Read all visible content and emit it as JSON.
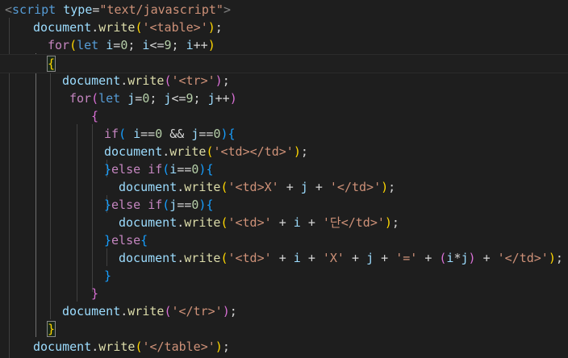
{
  "colors": {
    "background": "#1e1e1e",
    "tag": "#569cd6",
    "attribute": "#9cdcfe",
    "string": "#ce9178",
    "keyword": "#c586c0",
    "function": "#dcdcaa",
    "number": "#b5cea8",
    "bracket_level_1": "#ffd700",
    "bracket_level_2": "#da70d6",
    "bracket_level_3": "#179fff"
  },
  "lines": [
    [
      [
        "punc",
        "<"
      ],
      [
        "tag",
        "script"
      ],
      [
        "tok",
        " "
      ],
      [
        "attr",
        "type"
      ],
      [
        "tok",
        "="
      ],
      [
        "str",
        "\"text/javascript\""
      ],
      [
        "punc",
        ">"
      ]
    ],
    [
      [
        "var",
        "document"
      ],
      [
        "tok",
        "."
      ],
      [
        "fn",
        "write"
      ],
      [
        "b1",
        "("
      ],
      [
        "str",
        "'<table>'"
      ],
      [
        "b1",
        ")"
      ],
      [
        "tok",
        ";"
      ]
    ],
    [
      [
        "kw",
        "for"
      ],
      [
        "b1",
        "("
      ],
      [
        "decl",
        "let"
      ],
      [
        "tok",
        " "
      ],
      [
        "var",
        "i"
      ],
      [
        "op",
        "="
      ],
      [
        "num",
        "0"
      ],
      [
        "tok",
        "; "
      ],
      [
        "var",
        "i"
      ],
      [
        "op",
        "<="
      ],
      [
        "num",
        "9"
      ],
      [
        "tok",
        "; "
      ],
      [
        "var",
        "i"
      ],
      [
        "op",
        "++"
      ],
      [
        "b1",
        ")"
      ]
    ],
    [
      [
        "b1",
        "{"
      ]
    ],
    [
      [
        "var",
        "document"
      ],
      [
        "tok",
        "."
      ],
      [
        "fn",
        "write"
      ],
      [
        "b2",
        "("
      ],
      [
        "str",
        "'<tr>'"
      ],
      [
        "b2",
        ")"
      ],
      [
        "tok",
        ";"
      ]
    ],
    [
      [
        "kw",
        "for"
      ],
      [
        "b2",
        "("
      ],
      [
        "decl",
        "let"
      ],
      [
        "tok",
        " "
      ],
      [
        "var",
        "j"
      ],
      [
        "op",
        "="
      ],
      [
        "num",
        "0"
      ],
      [
        "tok",
        "; "
      ],
      [
        "var",
        "j"
      ],
      [
        "op",
        "<="
      ],
      [
        "num",
        "9"
      ],
      [
        "tok",
        "; "
      ],
      [
        "var",
        "j"
      ],
      [
        "op",
        "++"
      ],
      [
        "b2",
        ")"
      ]
    ],
    [
      [
        "b2",
        "{"
      ]
    ],
    [
      [
        "kw",
        "if"
      ],
      [
        "b3",
        "("
      ],
      [
        "tok",
        " "
      ],
      [
        "var",
        "i"
      ],
      [
        "op",
        "=="
      ],
      [
        "num",
        "0"
      ],
      [
        "tok",
        " "
      ],
      [
        "op",
        "&&"
      ],
      [
        "tok",
        " "
      ],
      [
        "var",
        "j"
      ],
      [
        "op",
        "=="
      ],
      [
        "num",
        "0"
      ],
      [
        "b3",
        ")"
      ],
      [
        "b3",
        "{"
      ]
    ],
    [
      [
        "var",
        "document"
      ],
      [
        "tok",
        "."
      ],
      [
        "fn",
        "write"
      ],
      [
        "b1",
        "("
      ],
      [
        "str",
        "'<td></td>'"
      ],
      [
        "b1",
        ")"
      ],
      [
        "tok",
        ";"
      ]
    ],
    [
      [
        "b3",
        "}"
      ],
      [
        "kw",
        "else"
      ],
      [
        "tok",
        " "
      ],
      [
        "kw",
        "if"
      ],
      [
        "b3",
        "("
      ],
      [
        "var",
        "i"
      ],
      [
        "op",
        "=="
      ],
      [
        "num",
        "0"
      ],
      [
        "b3",
        ")"
      ],
      [
        "b3",
        "{"
      ]
    ],
    [
      [
        "var",
        "document"
      ],
      [
        "tok",
        "."
      ],
      [
        "fn",
        "write"
      ],
      [
        "b1",
        "("
      ],
      [
        "str",
        "'<td>X'"
      ],
      [
        "tok",
        " "
      ],
      [
        "op",
        "+"
      ],
      [
        "tok",
        " "
      ],
      [
        "var",
        "j"
      ],
      [
        "tok",
        " "
      ],
      [
        "op",
        "+"
      ],
      [
        "tok",
        " "
      ],
      [
        "str",
        "'</td>'"
      ],
      [
        "b1",
        ")"
      ],
      [
        "tok",
        ";"
      ]
    ],
    [
      [
        "b3",
        "}"
      ],
      [
        "kw",
        "else"
      ],
      [
        "tok",
        " "
      ],
      [
        "kw",
        "if"
      ],
      [
        "b3",
        "("
      ],
      [
        "var",
        "j"
      ],
      [
        "op",
        "=="
      ],
      [
        "num",
        "0"
      ],
      [
        "b3",
        ")"
      ],
      [
        "b3",
        "{"
      ]
    ],
    [
      [
        "var",
        "document"
      ],
      [
        "tok",
        "."
      ],
      [
        "fn",
        "write"
      ],
      [
        "b1",
        "("
      ],
      [
        "str",
        "'<td>'"
      ],
      [
        "tok",
        " "
      ],
      [
        "op",
        "+"
      ],
      [
        "tok",
        " "
      ],
      [
        "var",
        "i"
      ],
      [
        "tok",
        " "
      ],
      [
        "op",
        "+"
      ],
      [
        "tok",
        " "
      ],
      [
        "str",
        "'단</td>'"
      ],
      [
        "b1",
        ")"
      ],
      [
        "tok",
        ";"
      ]
    ],
    [
      [
        "b3",
        "}"
      ],
      [
        "kw",
        "else"
      ],
      [
        "b3",
        "{"
      ]
    ],
    [
      [
        "var",
        "document"
      ],
      [
        "tok",
        "."
      ],
      [
        "fn",
        "write"
      ],
      [
        "b1",
        "("
      ],
      [
        "str",
        "'<td>'"
      ],
      [
        "tok",
        " "
      ],
      [
        "op",
        "+"
      ],
      [
        "tok",
        " "
      ],
      [
        "var",
        "i"
      ],
      [
        "tok",
        " "
      ],
      [
        "op",
        "+"
      ],
      [
        "tok",
        " "
      ],
      [
        "str",
        "'X'"
      ],
      [
        "tok",
        " "
      ],
      [
        "op",
        "+"
      ],
      [
        "tok",
        " "
      ],
      [
        "var",
        "j"
      ],
      [
        "tok",
        " "
      ],
      [
        "op",
        "+"
      ],
      [
        "tok",
        " "
      ],
      [
        "str",
        "'='"
      ],
      [
        "tok",
        " "
      ],
      [
        "op",
        "+"
      ],
      [
        "tok",
        " "
      ],
      [
        "b2",
        "("
      ],
      [
        "var",
        "i"
      ],
      [
        "op",
        "*"
      ],
      [
        "var",
        "j"
      ],
      [
        "b2",
        ")"
      ],
      [
        "tok",
        " "
      ],
      [
        "op",
        "+"
      ],
      [
        "tok",
        " "
      ],
      [
        "str",
        "'</td>'"
      ],
      [
        "b1",
        ")"
      ],
      [
        "tok",
        ";"
      ]
    ],
    [
      [
        "b3",
        "}"
      ]
    ],
    [
      [
        "b2",
        "}"
      ]
    ],
    [
      [
        "var",
        "document"
      ],
      [
        "tok",
        "."
      ],
      [
        "fn",
        "write"
      ],
      [
        "b2",
        "("
      ],
      [
        "str",
        "'</tr>'"
      ],
      [
        "b2",
        ")"
      ],
      [
        "tok",
        ";"
      ]
    ],
    [
      [
        "b1",
        "}"
      ]
    ],
    [
      [
        "var",
        "document"
      ],
      [
        "tok",
        "."
      ],
      [
        "fn",
        "write"
      ],
      [
        "b1",
        "("
      ],
      [
        "str",
        "'</table>'"
      ],
      [
        "b1",
        ")"
      ],
      [
        "tok",
        ";"
      ]
    ]
  ]
}
